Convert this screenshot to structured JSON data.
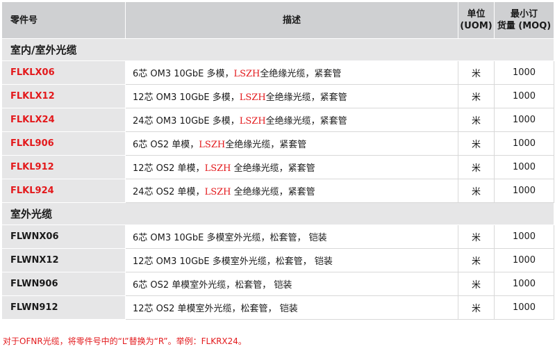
{
  "header": {
    "part_number": "零件号",
    "description": "描述",
    "uom_line1": "单位",
    "uom_line2": "(UOM)",
    "moq_line1": "最小订",
    "moq_line2": "货量 (MOQ)"
  },
  "sections": [
    {
      "title": "室内/室外光缆",
      "rows": [
        {
          "part": "FLKLX06",
          "desc_pre": "6芯 OM3 10GbE 多模，",
          "desc_mid": "LSZH",
          "desc_post": "全绝缘光缆，紧套管",
          "uom": "米",
          "moq": "1000"
        },
        {
          "part": "FLKLX12",
          "desc_pre": "12芯 OM3 10GbE 多模，",
          "desc_mid": "LSZH",
          "desc_post": "全绝缘光缆，紧套管",
          "uom": "米",
          "moq": "1000"
        },
        {
          "part": "FLKLX24",
          "desc_pre": "24芯 OM3 10GbE 多模，",
          "desc_mid": "LSZH",
          "desc_post": "全绝缘光缆，紧套管",
          "uom": "米",
          "moq": "1000"
        },
        {
          "part": "FLKL906",
          "desc_pre": "6芯 OS2 单模，",
          "desc_mid": "LSZH",
          "desc_post": "全绝缘光缆，紧套管",
          "uom": "米",
          "moq": "1000"
        },
        {
          "part": "FLKL912",
          "desc_pre": "12芯 OS2 单模，",
          "desc_mid": "LSZH",
          "desc_post": " 全绝缘光缆，紧套管",
          "uom": "米",
          "moq": "1000"
        },
        {
          "part": "FLKL924",
          "desc_pre": "24芯 OS2 单模，",
          "desc_mid": "LSZH",
          "desc_post": " 全绝缘光缆，紧套管",
          "uom": "米",
          "moq": "1000"
        }
      ]
    },
    {
      "title": "室外光缆",
      "rows": [
        {
          "part": "FLWNX06",
          "desc": "6芯 OM3 10GbE 多模室外光缆，松套管， 铠装",
          "uom": "米",
          "moq": "1000"
        },
        {
          "part": "FLWNX12",
          "desc": "12芯 OM3 10GbE 多模室外光缆，松套管， 铠装",
          "uom": "米",
          "moq": "1000"
        },
        {
          "part": "FLWN906",
          "desc": "6芯 OS2 单模室外光缆，松套管， 铠装",
          "uom": "米",
          "moq": "1000"
        },
        {
          "part": "FLWN912",
          "desc": "12芯 OS2 单模室外光缆，松套管， 铠装",
          "uom": "米",
          "moq": "1000"
        }
      ]
    }
  ],
  "footnote": "对于OFNR光缆，将零件号中的“L”替换为“R”。举例：FLKRX24。",
  "colors": {
    "accent_red": "#e3191c",
    "header_gray": "#cfd0d2",
    "cell_gray": "#e6e6e7"
  }
}
